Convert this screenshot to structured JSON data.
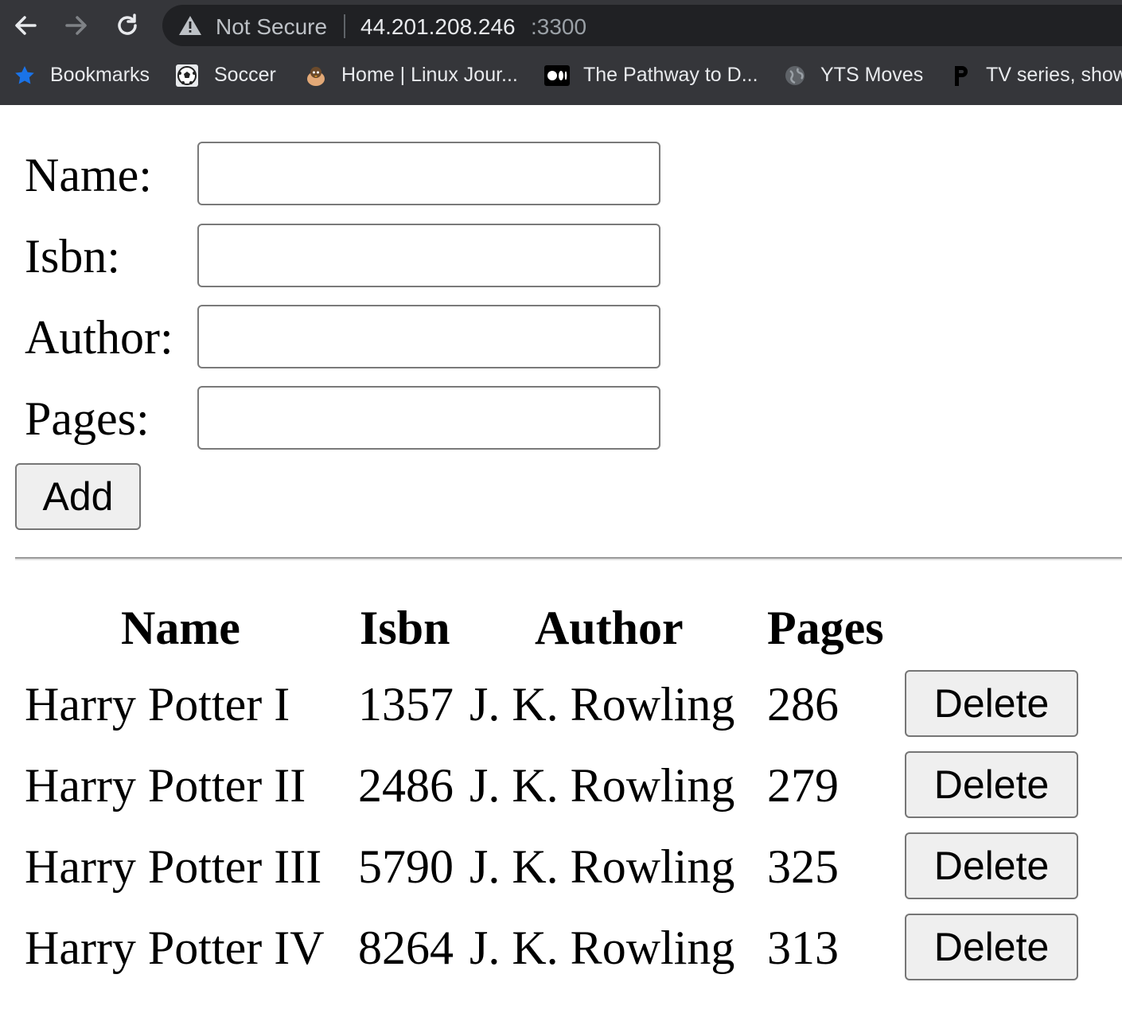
{
  "browser": {
    "not_secure_label": "Not Secure",
    "url_host": "44.201.208.246",
    "url_port": ":3300",
    "bookmarks": [
      {
        "icon": "star-icon",
        "label": "Bookmarks"
      },
      {
        "icon": "soccer-ball-icon",
        "label": "Soccer"
      },
      {
        "icon": "penguin-icon",
        "label": "Home | Linux Jour..."
      },
      {
        "icon": "medium-icon",
        "label": "The Pathway to D..."
      },
      {
        "icon": "globe-icon",
        "label": "YTS Moves"
      },
      {
        "icon": "p-letter-icon",
        "label": "TV series, show"
      }
    ]
  },
  "form": {
    "name_label": "Name:",
    "isbn_label": "Isbn:",
    "author_label": "Author:",
    "pages_label": "Pages:",
    "name_value": "",
    "isbn_value": "",
    "author_value": "",
    "pages_value": "",
    "add_label": "Add"
  },
  "table": {
    "headers": [
      "Name",
      "Isbn",
      "Author",
      "Pages"
    ],
    "delete_label": "Delete",
    "rows": [
      {
        "name": "Harry Potter I",
        "isbn": "1357",
        "author": "J. K. Rowling",
        "pages": "286"
      },
      {
        "name": "Harry Potter II",
        "isbn": "2486",
        "author": "J. K. Rowling",
        "pages": "279"
      },
      {
        "name": "Harry Potter III",
        "isbn": "5790",
        "author": "J. K. Rowling",
        "pages": "325"
      },
      {
        "name": "Harry Potter IV",
        "isbn": "8264",
        "author": "J. K. Rowling",
        "pages": "313"
      }
    ]
  }
}
